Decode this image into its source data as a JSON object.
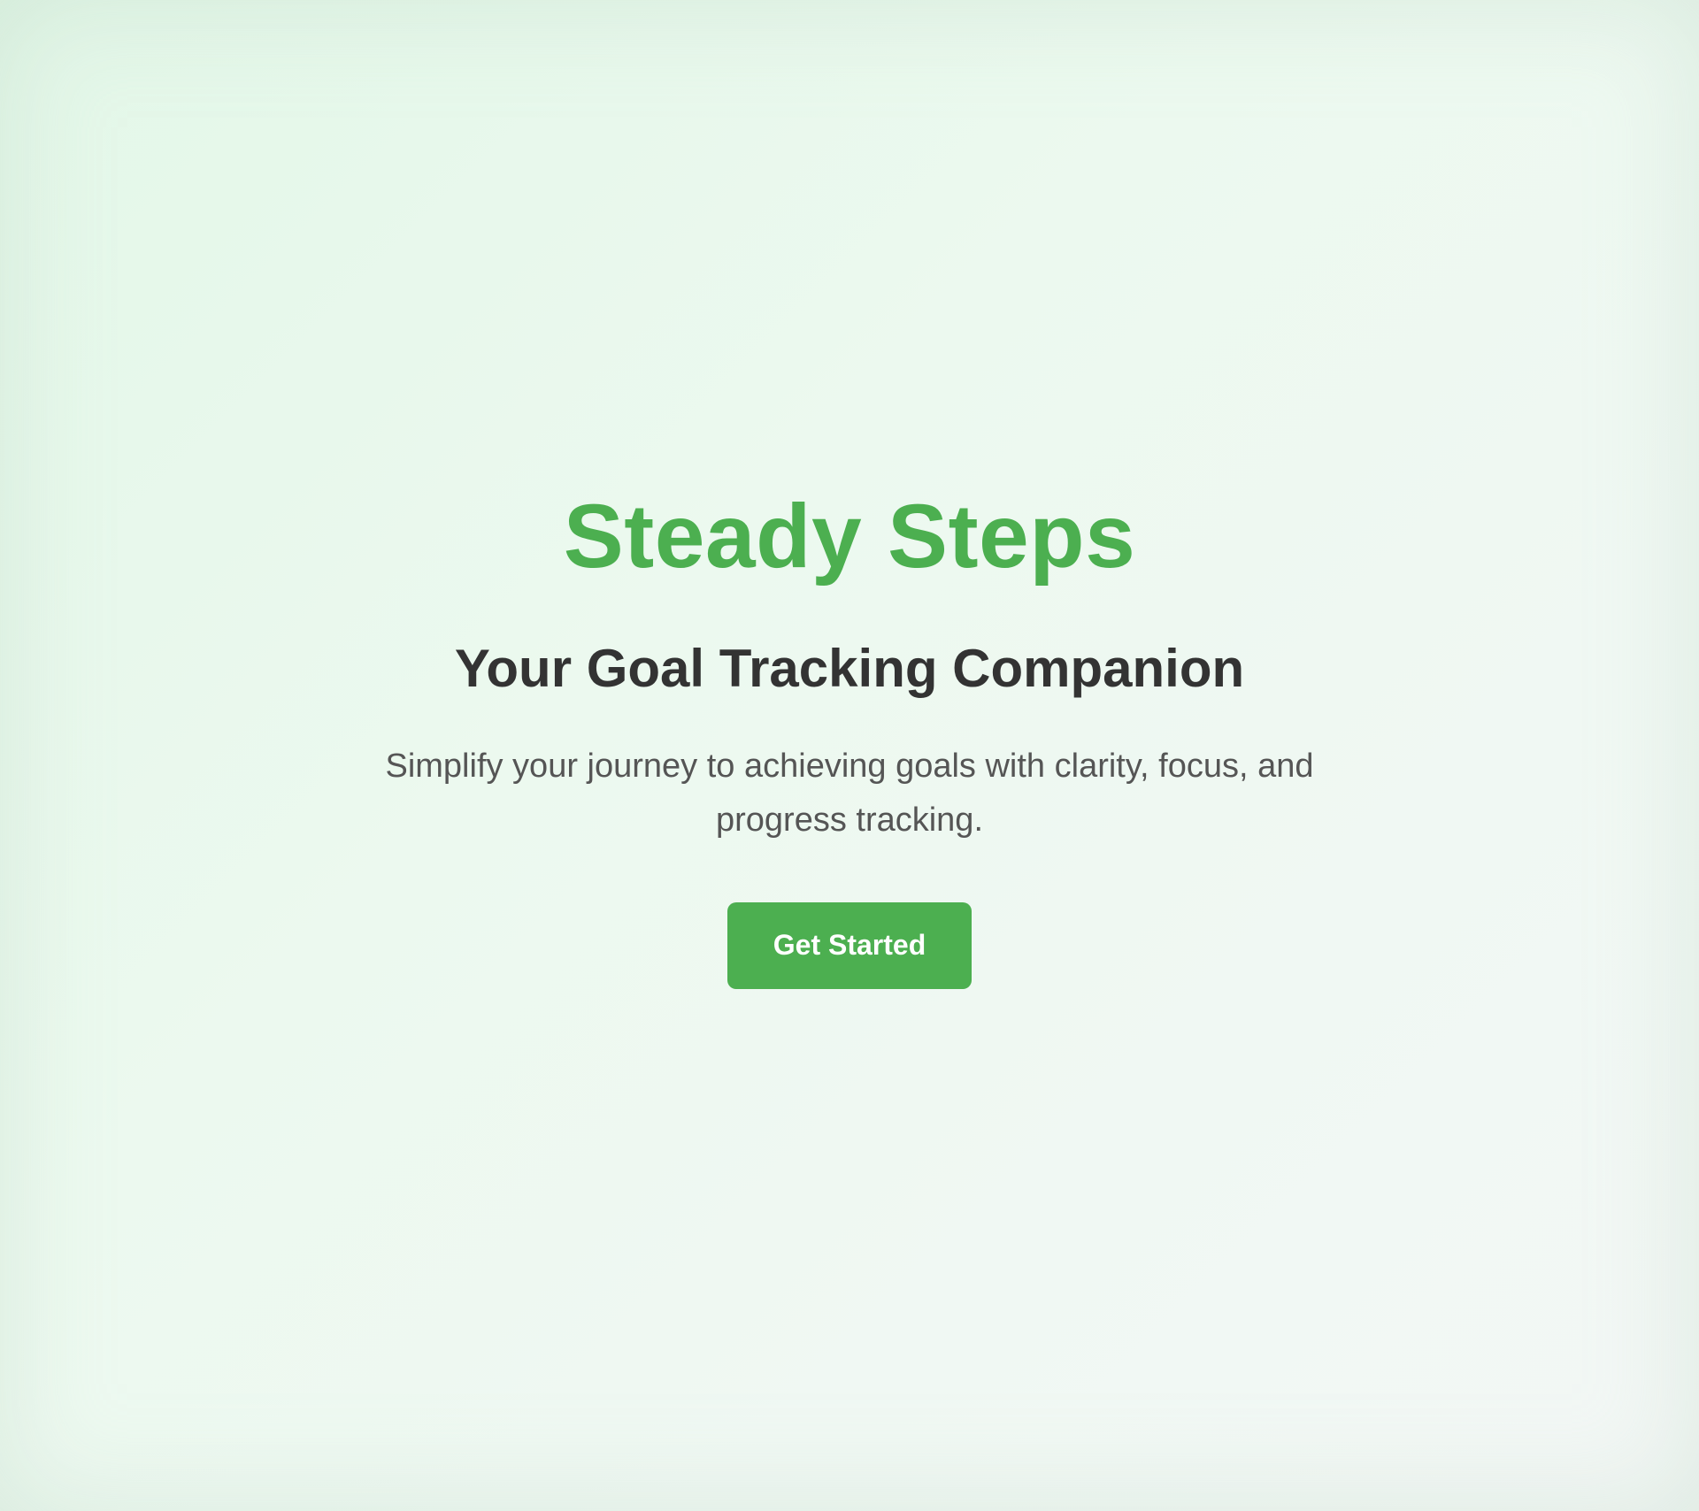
{
  "hero": {
    "brand": "Steady Steps",
    "tagline": "Your Goal Tracking Companion",
    "description": "Simplify your journey to achieving goals with clarity, focus, and progress tracking.",
    "cta_label": "Get Started"
  },
  "colors": {
    "accent": "#4caf50",
    "heading": "#333333",
    "body_text": "#555555",
    "background": "#eaf8ee"
  }
}
